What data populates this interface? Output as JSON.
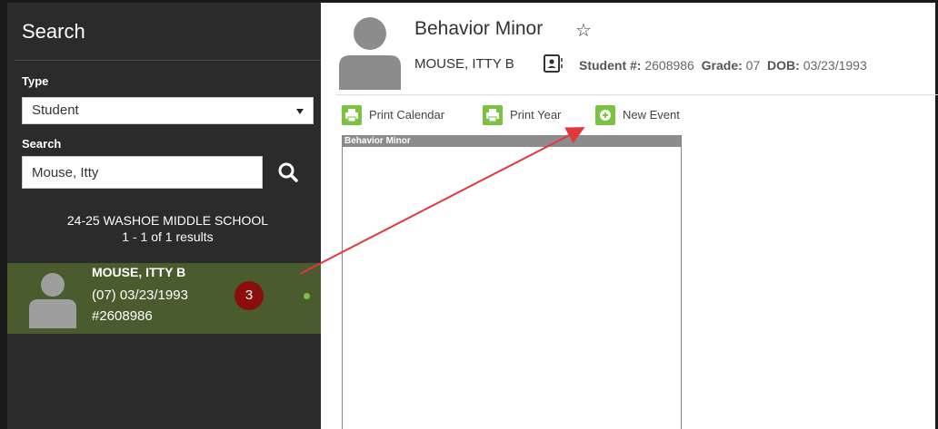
{
  "sidebar": {
    "title": "Search",
    "type_label": "Type",
    "type_value": "Student",
    "search_label": "Search",
    "search_value": "Mouse, Itty",
    "school_name": "24-25 WASHOE MIDDLE SCHOOL",
    "result_count": "1 - 1 of 1 results",
    "result": {
      "name": "MOUSE, ITTY B",
      "grade_dob": "(07) 03/23/1993",
      "student_id": "#2608986",
      "badge": "3",
      "status_color": "#7bc142"
    }
  },
  "header": {
    "title": "Behavior Minor",
    "student_name": "MOUSE, ITTY B",
    "student_num_label": "Student #:",
    "student_num": "2608986",
    "grade_label": "Grade:",
    "grade": "07",
    "dob_label": "DOB:",
    "dob": "03/23/1993"
  },
  "toolbar": {
    "print_calendar": "Print Calendar",
    "print_year": "Print Year",
    "new_event": "New Event"
  },
  "panel": {
    "title": "Behavior Minor"
  },
  "colors": {
    "sidebar_bg": "#2b2b2b",
    "result_bg": "#4a5b2d",
    "badge_bg": "#8b0e0e",
    "accent_green": "#7bc142",
    "annotation_arrow": "#e0383e"
  },
  "icons": [
    "search-icon",
    "star-icon",
    "contact-card-icon",
    "printer-icon",
    "plus-circle-icon",
    "avatar-placeholder"
  ]
}
